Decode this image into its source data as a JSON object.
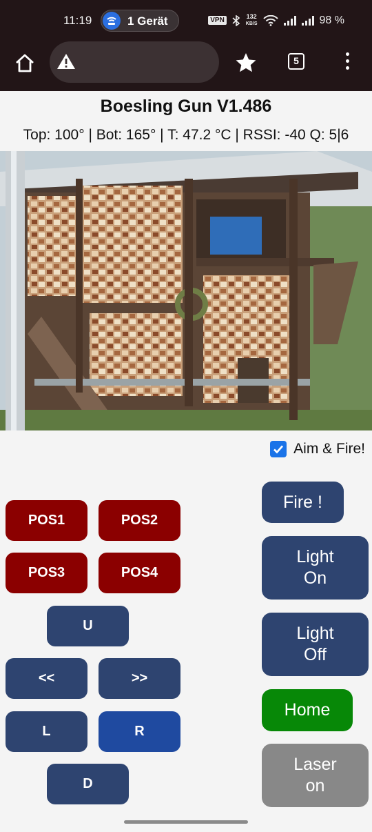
{
  "status_bar": {
    "time": "11:19",
    "notification_pill": "1 Gerät",
    "vpn_label": "VPN",
    "speed_value": "132",
    "speed_unit": "KB/S",
    "battery": "98 %"
  },
  "browser": {
    "home_icon": "home-icon",
    "security_icon": "warning-triangle-icon",
    "bookmark_icon": "star-icon",
    "tab_count": "5",
    "menu_icon": "more-vertical-icon"
  },
  "page": {
    "title": "Boesling Gun V1.486",
    "telemetry": "Top: 100° | Bot: 165° | T: 47.2 °C | RSSI: -40 Q: 5|6",
    "aim_fire_label": "Aim & Fire!",
    "aim_fire_checked": true
  },
  "positions": [
    "POS1",
    "POS2",
    "POS3",
    "POS4"
  ],
  "movement": {
    "up": "U",
    "fast_left": "<<",
    "fast_right": ">>",
    "left": "L",
    "right": "R",
    "down": "D"
  },
  "actions": {
    "fire": "Fire !",
    "light_on": "Light\nOn",
    "light_off": "Light\nOff",
    "home": "Home",
    "laser_on": "Laser\non"
  },
  "colors": {
    "position_buttons": "#8b0000",
    "movement_buttons": "#2e4470",
    "right_button": "#1f4aa0",
    "home_button": "#078807",
    "laser_button": "#888888"
  }
}
